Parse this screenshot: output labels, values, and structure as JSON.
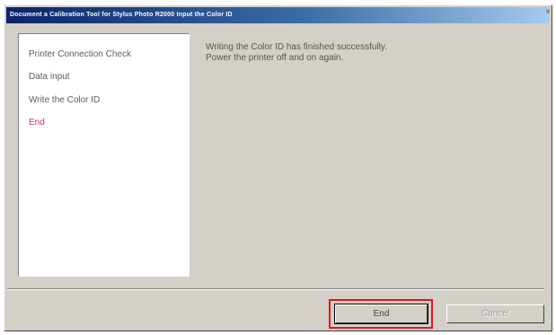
{
  "window": {
    "title": "Document a Calibration Tool for Stylus Photo R2000 Input the Color ID",
    "close_glyph": "×"
  },
  "steps": [
    {
      "label": "Printer Connection Check",
      "active": false
    },
    {
      "label": "Data input",
      "active": false
    },
    {
      "label": "Write the Color ID",
      "active": false
    },
    {
      "label": "End",
      "active": true
    }
  ],
  "message": {
    "line1": "Writing the Color ID has finished successfully.",
    "line2": "Power the printer off and on again."
  },
  "buttons": {
    "end_label": "End",
    "cancel_label": "Cancel"
  },
  "colors": {
    "active_step": "#d9305a",
    "highlight": "#e8141e",
    "titlebar_start": "#0a246a"
  }
}
